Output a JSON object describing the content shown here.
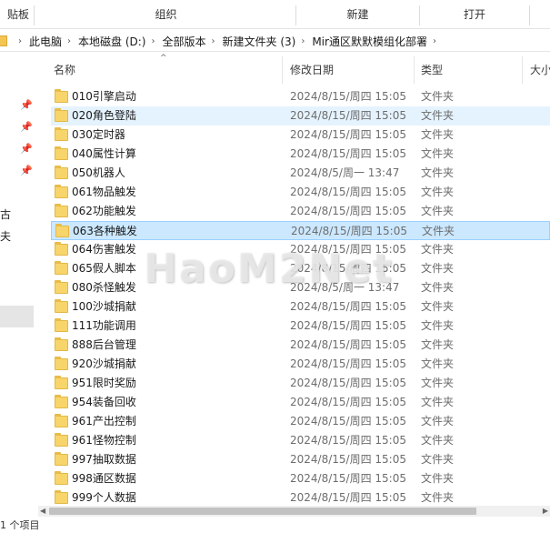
{
  "ribbon": {
    "groups": [
      "贴板",
      "组织",
      "新建",
      "打开"
    ]
  },
  "address": {
    "crumbs": [
      "此电脑",
      "本地磁盘 (D:)",
      "全部版本",
      "新建文件夹 (3)",
      "Mir通区默默模组化部署"
    ]
  },
  "nav": {
    "text1": "古",
    "text2": "夫"
  },
  "columns": {
    "name": "名称",
    "modified": "修改日期",
    "type": "类型",
    "size": "大小"
  },
  "files": [
    {
      "name": "010引擎启动",
      "date": "2024/8/15/周四 15:05",
      "type": "文件夹"
    },
    {
      "name": "020角色登陆",
      "date": "2024/8/15/周四 15:05",
      "type": "文件夹"
    },
    {
      "name": "030定时器",
      "date": "2024/8/15/周四 15:05",
      "type": "文件夹"
    },
    {
      "name": "040属性计算",
      "date": "2024/8/15/周四 15:05",
      "type": "文件夹"
    },
    {
      "name": "050机器人",
      "date": "2024/8/5/周一 13:47",
      "type": "文件夹"
    },
    {
      "name": "061物品触发",
      "date": "2024/8/15/周四 15:05",
      "type": "文件夹"
    },
    {
      "name": "062功能触发",
      "date": "2024/8/15/周四 15:05",
      "type": "文件夹"
    },
    {
      "name": "063各种触发",
      "date": "2024/8/15/周四 15:05",
      "type": "文件夹"
    },
    {
      "name": "064伤害触发",
      "date": "2024/8/15/周四 15:05",
      "type": "文件夹"
    },
    {
      "name": "065假人脚本",
      "date": "2024/8/15/周四 15:05",
      "type": "文件夹"
    },
    {
      "name": "080杀怪触发",
      "date": "2024/8/5/周一 13:47",
      "type": "文件夹"
    },
    {
      "name": "100沙城捐献",
      "date": "2024/8/15/周四 15:05",
      "type": "文件夹"
    },
    {
      "name": "111功能调用",
      "date": "2024/8/15/周四 15:05",
      "type": "文件夹"
    },
    {
      "name": "888后台管理",
      "date": "2024/8/15/周四 15:05",
      "type": "文件夹"
    },
    {
      "name": "920沙城捐献",
      "date": "2024/8/15/周四 15:05",
      "type": "文件夹"
    },
    {
      "name": "951限时奖励",
      "date": "2024/8/15/周四 15:05",
      "type": "文件夹"
    },
    {
      "name": "954装备回收",
      "date": "2024/8/15/周四 15:05",
      "type": "文件夹"
    },
    {
      "name": "961产出控制",
      "date": "2024/8/15/周四 15:05",
      "type": "文件夹"
    },
    {
      "name": "961怪物控制",
      "date": "2024/8/15/周四 15:05",
      "type": "文件夹"
    },
    {
      "name": "997抽取数据",
      "date": "2024/8/15/周四 15:05",
      "type": "文件夹"
    },
    {
      "name": "998通区数据",
      "date": "2024/8/15/周四 15:05",
      "type": "文件夹"
    },
    {
      "name": "999个人数据",
      "date": "2024/8/15/周四 15:05",
      "type": "文件夹"
    }
  ],
  "selected_index": 7,
  "hover_index": 1,
  "status": {
    "text": "1 个项目"
  },
  "watermark": "HaoM2Net",
  "colors": {
    "selection": "#cce8ff",
    "selection_border": "#99d1ff",
    "hover": "#e5f3ff",
    "folder": "#f8d56b"
  }
}
